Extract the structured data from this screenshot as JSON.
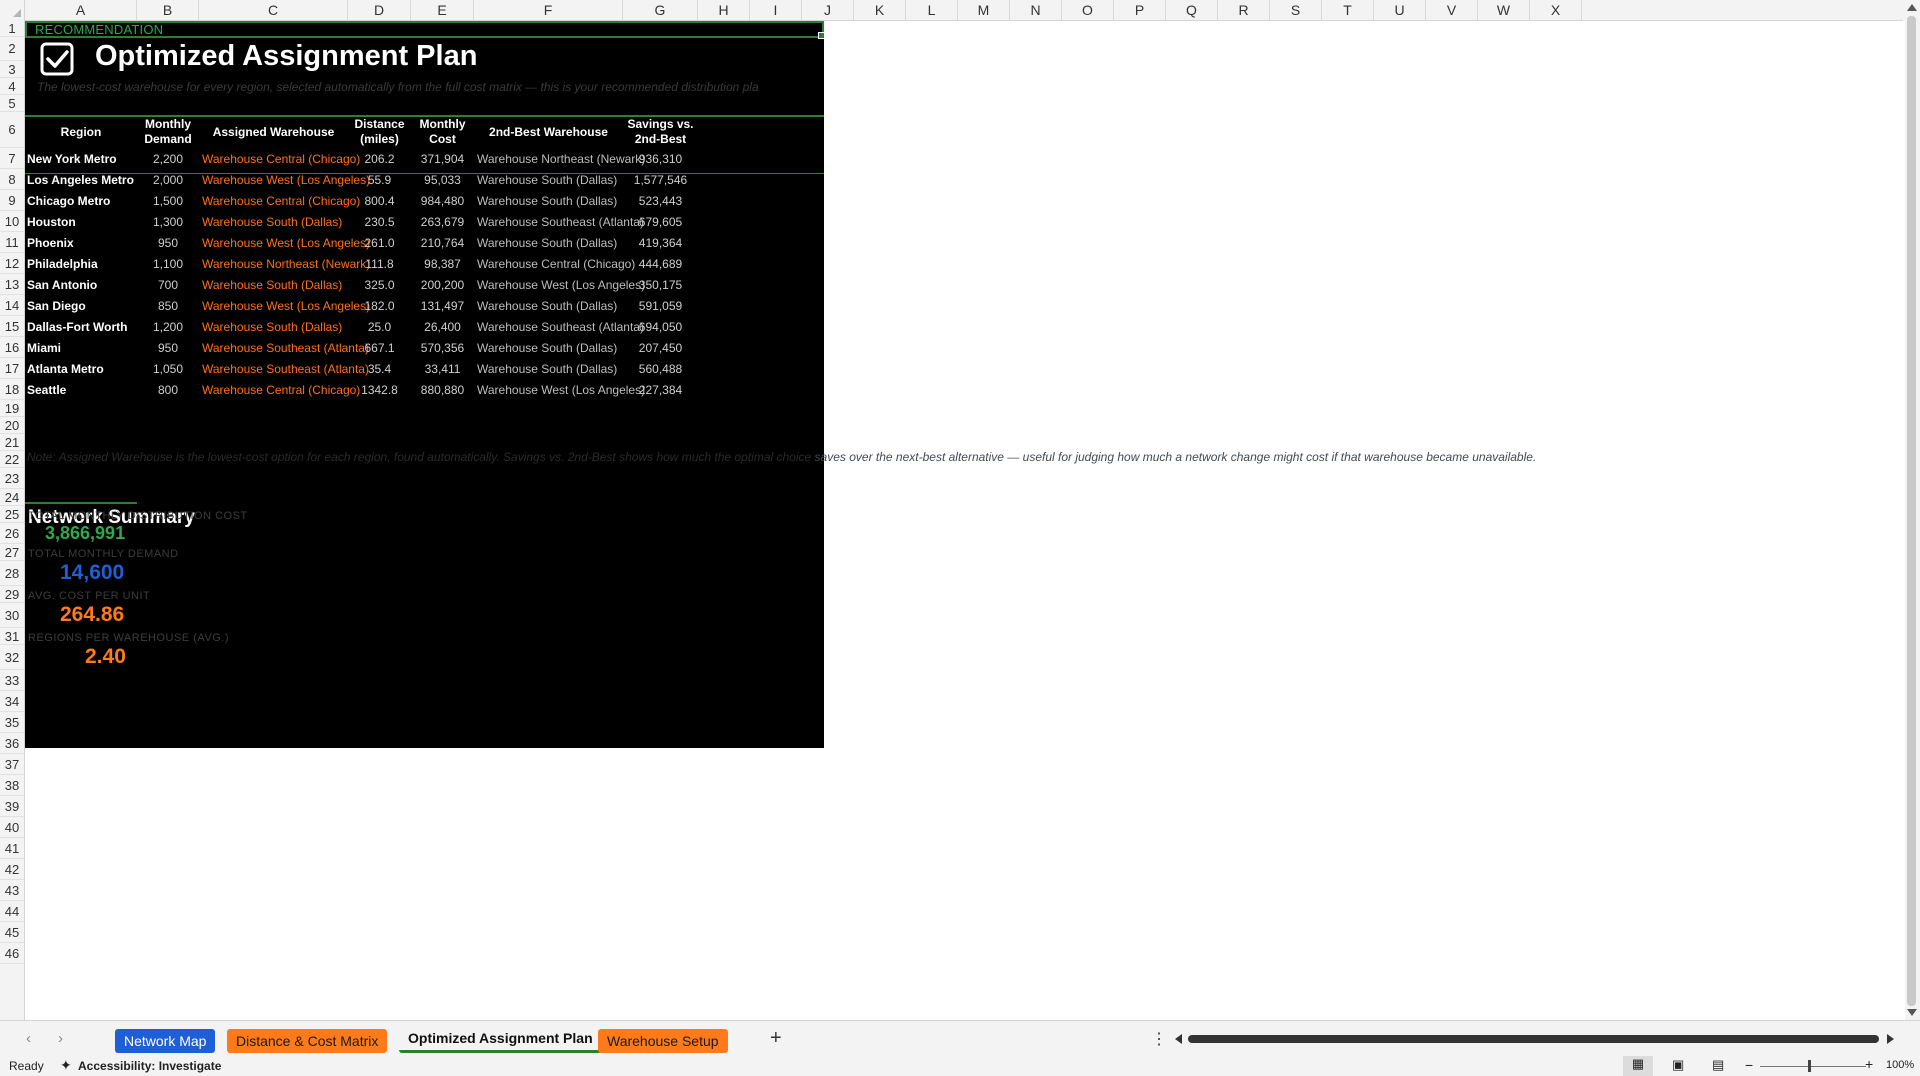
{
  "columns": [
    "A",
    "B",
    "C",
    "D",
    "E",
    "F",
    "G",
    "H",
    "I",
    "J",
    "K",
    "L",
    "M",
    "N",
    "O",
    "P",
    "Q",
    "R",
    "S",
    "T",
    "U",
    "V",
    "W",
    "X"
  ],
  "rows": [
    "1",
    "2",
    "3",
    "4",
    "5",
    "6",
    "7",
    "8",
    "9",
    "10",
    "11",
    "12",
    "13",
    "14",
    "15",
    "16",
    "17",
    "18",
    "19",
    "20",
    "21",
    "22",
    "23",
    "24",
    "25",
    "26",
    "27",
    "28",
    "29",
    "30",
    "31",
    "32",
    "33",
    "34",
    "35",
    "36",
    "37",
    "38",
    "39",
    "40",
    "41",
    "42",
    "43",
    "44",
    "45",
    "46"
  ],
  "sheet": {
    "banner": "RECOMMENDATION",
    "title": "Optimized Assignment Plan",
    "subtitle": "The lowest-cost warehouse for every region, selected automatically from the full cost matrix — this is your recommended distribution pla",
    "headers": [
      "Region",
      "Monthly Demand",
      "Assigned Warehouse",
      "Distance (miles)",
      "Monthly Cost",
      "2nd-Best Warehouse",
      "Savings vs. 2nd-Best"
    ],
    "table": [
      [
        "New York Metro",
        "2,200",
        "Warehouse Central (Chicago)",
        "206.2",
        "371,904",
        "Warehouse Northeast (Newark)",
        "936,310"
      ],
      [
        "Los Angeles Metro",
        "2,000",
        "Warehouse West (Los Angeles)",
        "55.9",
        "95,033",
        "Warehouse South (Dallas)",
        "1,577,546"
      ],
      [
        "Chicago Metro",
        "1,500",
        "Warehouse Central (Chicago)",
        "800.4",
        "984,480",
        "Warehouse South (Dallas)",
        "523,443"
      ],
      [
        "Houston",
        "1,300",
        "Warehouse South (Dallas)",
        "230.5",
        "263,679",
        "Warehouse Southeast (Atlanta)",
        "679,605"
      ],
      [
        "Phoenix",
        "950",
        "Warehouse West (Los Angeles)",
        "261.0",
        "210,764",
        "Warehouse South (Dallas)",
        "419,364"
      ],
      [
        "Philadelphia",
        "1,100",
        "Warehouse Northeast (Newark)",
        "111.8",
        "98,387",
        "Warehouse Central (Chicago)",
        "444,689"
      ],
      [
        "San Antonio",
        "700",
        "Warehouse South (Dallas)",
        "325.0",
        "200,200",
        "Warehouse West (Los Angeles)",
        "350,175"
      ],
      [
        "San Diego",
        "850",
        "Warehouse West (Los Angeles)",
        "182.0",
        "131,497",
        "Warehouse South (Dallas)",
        "591,059"
      ],
      [
        "Dallas-Fort Worth",
        "1,200",
        "Warehouse South (Dallas)",
        "25.0",
        "26,400",
        "Warehouse Southeast (Atlanta)",
        "694,050"
      ],
      [
        "Miami",
        "950",
        "Warehouse Southeast (Atlanta)",
        "667.1",
        "570,356",
        "Warehouse South (Dallas)",
        "207,450"
      ],
      [
        "Atlanta Metro",
        "1,050",
        "Warehouse Southeast (Atlanta)",
        "35.4",
        "33,411",
        "Warehouse South (Dallas)",
        "560,488"
      ],
      [
        "Seattle",
        "800",
        "Warehouse Central (Chicago)",
        "1342.8",
        "880,880",
        "Warehouse West (Los Angeles)",
        "227,384"
      ]
    ],
    "note_dark": "Note: Assigned Warehouse is the lowest-cost option for each region, found automatically. Savings vs. 2nd-Best shows how much the optimal choice",
    "note_overflow": " saves over the next-best alternative — useful for judging how much a network change might cost if that warehouse became unavailable.",
    "summary_title": "Network Summary",
    "kpis": [
      {
        "label": "TOTAL MONTHLY DISTRIBUTION COST",
        "value": "3,866,991",
        "color": "#2fa84f"
      },
      {
        "label": "TOTAL MONTHLY DEMAND",
        "value": "14,600",
        "color": "#1f5fd6"
      },
      {
        "label": "AVG. COST PER UNIT",
        "value": "264.86",
        "color": "#ff7a1a"
      },
      {
        "label": "REGIONS PER WAREHOUSE (AVG.)",
        "value": "2.40",
        "color": "#ff7a1a"
      }
    ]
  },
  "tabs": [
    {
      "label": "Network Map",
      "bg": "#1f5fd6",
      "fg": "#ffffff"
    },
    {
      "label": "Distance & Cost Matrix",
      "bg": "#ff7a1a",
      "fg": "#1a1a1a"
    },
    {
      "label": "Optimized Assignment Plan",
      "bg": "#e9f5ea",
      "fg": "#111111"
    },
    {
      "label": "Warehouse Setup",
      "bg": "#ff7a1a",
      "fg": "#1a1a1a"
    }
  ],
  "status": {
    "ready": "Ready",
    "accessibility": "Accessibility: Investigate",
    "zoom": "100%"
  }
}
